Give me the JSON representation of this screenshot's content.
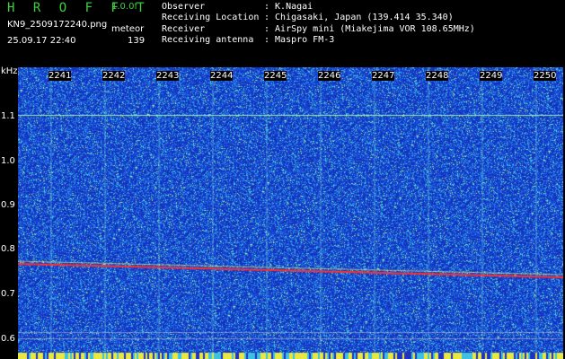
{
  "app": {
    "title": "H R O F F T",
    "version": "1.0.0f"
  },
  "file": {
    "name": "KN9_2509172240.png",
    "datetime": "25.09.17 22:40"
  },
  "meteor": {
    "label": "meteor",
    "count": "139"
  },
  "info": [
    {
      "label": "Observer",
      "value": ": K.Nagai"
    },
    {
      "label": "Receiving Location",
      "value": ": Chigasaki, Japan (139.414 35.340)"
    },
    {
      "label": "Receiver",
      "value": ": AirSpy mini (Miakejima VOR 108.65MHz)"
    },
    {
      "label": "Receiving antenna",
      "value": ": Maspro FM-3"
    }
  ],
  "axis": {
    "y_unit": "kHz",
    "y_ticks": [
      "1.1",
      "1.0",
      "0.9",
      "0.8",
      "0.7",
      "0.6"
    ],
    "x_ticks": [
      "2241",
      "2242",
      "2243",
      "2244",
      "2245",
      "2246",
      "2247",
      "2248",
      "2249",
      "2250"
    ]
  },
  "colors": {
    "background": "#1d3fd8",
    "signal": "#ff3030",
    "title": "#3fd03f"
  }
}
